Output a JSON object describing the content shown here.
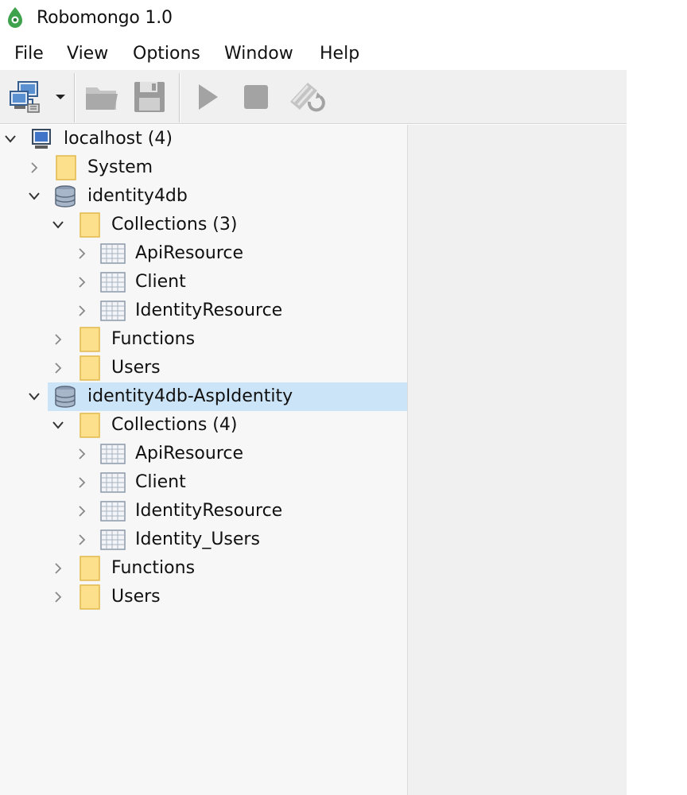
{
  "app": {
    "title": "Robomongo 1.0",
    "accent": "#3fa34d"
  },
  "menu": [
    "File",
    "View",
    "Options",
    "Window",
    "Help"
  ],
  "toolbar": {
    "buttons": [
      "connect-icon",
      "open-folder-icon",
      "save-icon",
      "execute-icon",
      "stop-icon",
      "orientation-icon"
    ]
  },
  "tree": {
    "server": {
      "label": "localhost (4)"
    },
    "system": {
      "label": "System"
    },
    "db1": {
      "label": "identity4db",
      "collections_label": "Collections (3)",
      "collections": [
        "ApiResource",
        "Client",
        "IdentityResource"
      ],
      "functions_label": "Functions",
      "users_label": "Users"
    },
    "db2": {
      "label": "identity4db-AspIdentity",
      "selected": true,
      "collections_label": "Collections (4)",
      "collections": [
        "ApiResource",
        "Client",
        "IdentityResource",
        "Identity_Users"
      ],
      "functions_label": "Functions",
      "users_label": "Users"
    }
  },
  "colors": {
    "selection": "#cce4f7",
    "folder": "#fde08b",
    "panel": "#f7f7f7"
  }
}
